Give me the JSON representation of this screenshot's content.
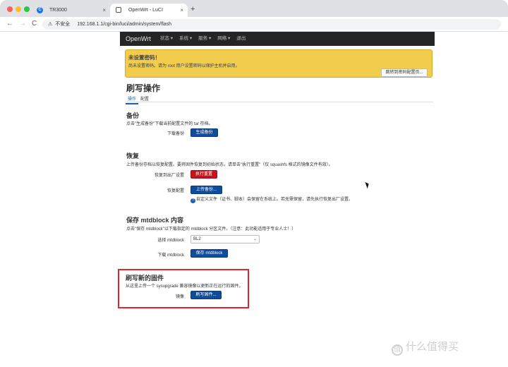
{
  "browser": {
    "tabs": [
      {
        "title": "TR3000",
        "favicon": "C"
      },
      {
        "title": "OpenWrt - LuCI"
      }
    ],
    "close_glyph": "×",
    "new_tab_glyph": "+",
    "nav": {
      "back": "←",
      "forward": "→",
      "reload": "C"
    },
    "security_warning": "不安全",
    "url": "192.168.1.1/cgi-bin/luci/admin/system/flash"
  },
  "openwrt": {
    "brand": "OpenWrt",
    "menu": [
      "状态 ▾",
      "系统 ▾",
      "服务 ▾",
      "网络 ▾",
      "退出"
    ]
  },
  "alert": {
    "title": "未设置密码！",
    "text": "尚未设置密码。请为 root 用户设置密码以保护主机并启用。",
    "button": "跳转到密码配置页..."
  },
  "page": {
    "title": "刷写操作",
    "tabs": [
      "操作",
      "配置"
    ]
  },
  "backup": {
    "title": "备份",
    "desc": "点击\"生成备份\"下载当前配置文件的 tar 存档。",
    "label": "下载备份",
    "button": "生成备份"
  },
  "restore": {
    "title": "恢复",
    "desc": "上传备份存档以恢复配置。要将固件恢复到初始状态，请单击\"执行重置\"（仅 squashfs 格式的镜像文件有效）。",
    "reset_label": "恢复到出厂设置",
    "reset_button": "执行重置",
    "restore_label": "恢复配置",
    "upload_button": "上传备份...",
    "help": "自定义文件（证书、脚本）会保留在系统上。若无需保留，请先执行恢复出厂设置。"
  },
  "mtdblock": {
    "title": "保存 mtdblock 内容",
    "desc": "点击\"保存 mtdblock\"以下载指定的 mtdblock 分区文件。（注意：此功能适用于专业人士！）",
    "select_label": "选择 mtdblock",
    "selected": "BL2",
    "download_label": "下载 mtdblock",
    "save_button": "保存 mtdblock"
  },
  "flash": {
    "title": "刷写新的固件",
    "desc": "从这里上传一个 sysupgrade 兼容镜像以更新正在运行的固件。",
    "image_label": "镜像",
    "button": "刷写固件..."
  },
  "watermark": {
    "logo": "值",
    "text": "什么值得买"
  },
  "colors": {
    "nav_bg": "#252525",
    "alert_bg": "#f2cc4c",
    "primary": "#0f4c9c",
    "danger": "#c5141e",
    "highlight": "#e0262e"
  }
}
